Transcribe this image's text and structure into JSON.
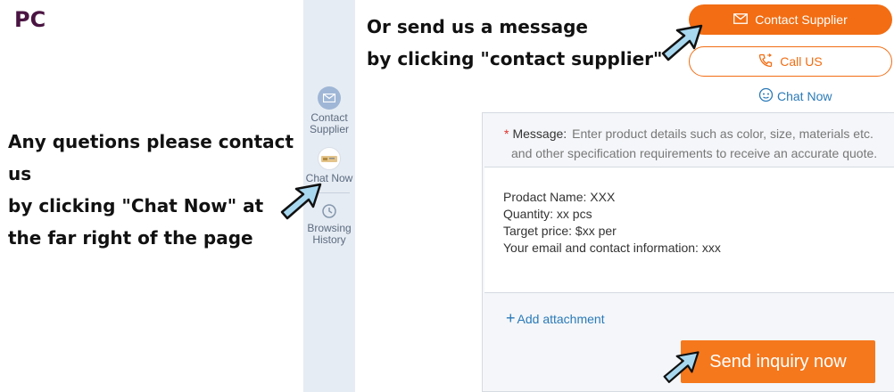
{
  "annotations": {
    "platform_label": "PC",
    "left_note": [
      "Any quetions please contact us",
      "by clicking \"Chat Now\" at",
      "the far right of the page"
    ],
    "top_note": [
      "Or send us a message",
      "by clicking \"contact supplier\""
    ]
  },
  "sidebar": {
    "contact_label_1": "Contact",
    "contact_label_2": "Supplier",
    "chat_label": "Chat Now",
    "history_label_1": "Browsing",
    "history_label_2": "History"
  },
  "actions": {
    "contact_supplier": "Contact Supplier",
    "call_us": "Call US",
    "chat_now": "Chat Now"
  },
  "form": {
    "required_mark": "*",
    "message_label": "Message:",
    "placeholder_line1": "Enter product details such as color, size, materials etc.",
    "placeholder_line2": "and other specification requirements to receive an accurate quote.",
    "body_lines": [
      "Prodact Name: XXX",
      "Quantity: xx pcs",
      "Target price: $xx per",
      "Your email and contact information: xxx"
    ],
    "attach_plus": "+",
    "attach_label": "Add attachment",
    "send_label": "Send inquiry now"
  },
  "colors": {
    "accent_orange": "#f26d13",
    "link_blue": "#2a7ab8",
    "sidebar_bg": "#e6ecf3",
    "arrow_fill": "#a8d8f0"
  },
  "icons": [
    "mail-icon",
    "phone-icon",
    "chat-bubble-icon",
    "clock-icon",
    "cursor-arrow-icon"
  ]
}
